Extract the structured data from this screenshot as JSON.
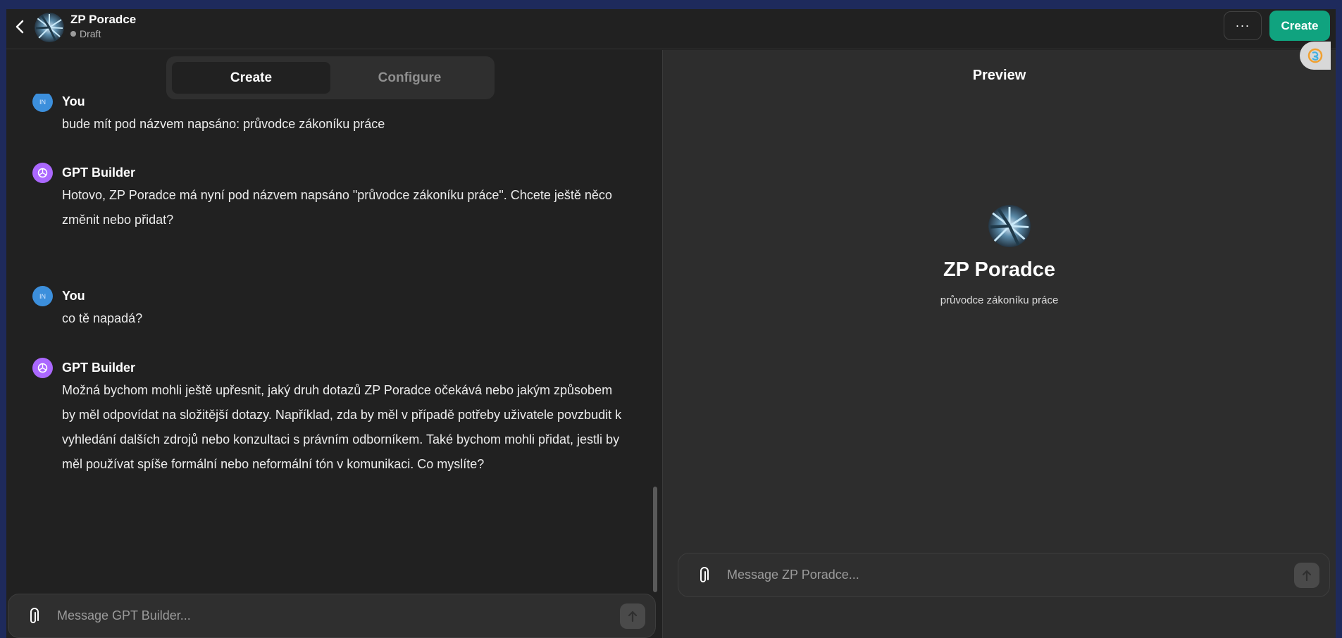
{
  "topbar": {
    "title": "ZP Poradce",
    "status": "Draft",
    "more_label": "···",
    "create_label": "Create"
  },
  "tabs": [
    {
      "label": "Create",
      "active": true
    },
    {
      "label": "Configure",
      "active": false
    }
  ],
  "messages": [
    {
      "author": "You",
      "avatar": "IN",
      "text": "bude  mít pod názvem napsáno: průvodce zákoníku práce"
    },
    {
      "author": "GPT Builder",
      "text": "Hotovo, ZP Poradce má nyní pod názvem napsáno \"průvodce zákoníku práce\". Chcete ještě něco změnit nebo přidat?"
    },
    {
      "author": "You",
      "avatar": "IN",
      "text": "co tě napadá?"
    },
    {
      "author": "GPT Builder",
      "text": "Možná bychom mohli ještě upřesnit, jaký druh dotazů ZP Poradce očekává nebo jakým způsobem by měl odpovídat na složitější dotazy. Například, zda by měl v případě potřeby uživatele povzbudit k vyhledání dalších zdrojů nebo konzultaci s právním odborníkem. Také bychom mohli přidat, jestli by měl používat spíše formální nebo neformální tón v komunikaci. Co myslíte?"
    }
  ],
  "left_input": {
    "placeholder": "Message GPT Builder..."
  },
  "preview": {
    "label": "Preview",
    "title": "ZP Poradce",
    "description": "průvodce zákoníku práce"
  },
  "right_input": {
    "placeholder": "Message ZP Poradce..."
  },
  "colors": {
    "accent": "#10a37f",
    "bot_avatar": "#ab68ff",
    "user_avatar": "#3c8fdc"
  }
}
